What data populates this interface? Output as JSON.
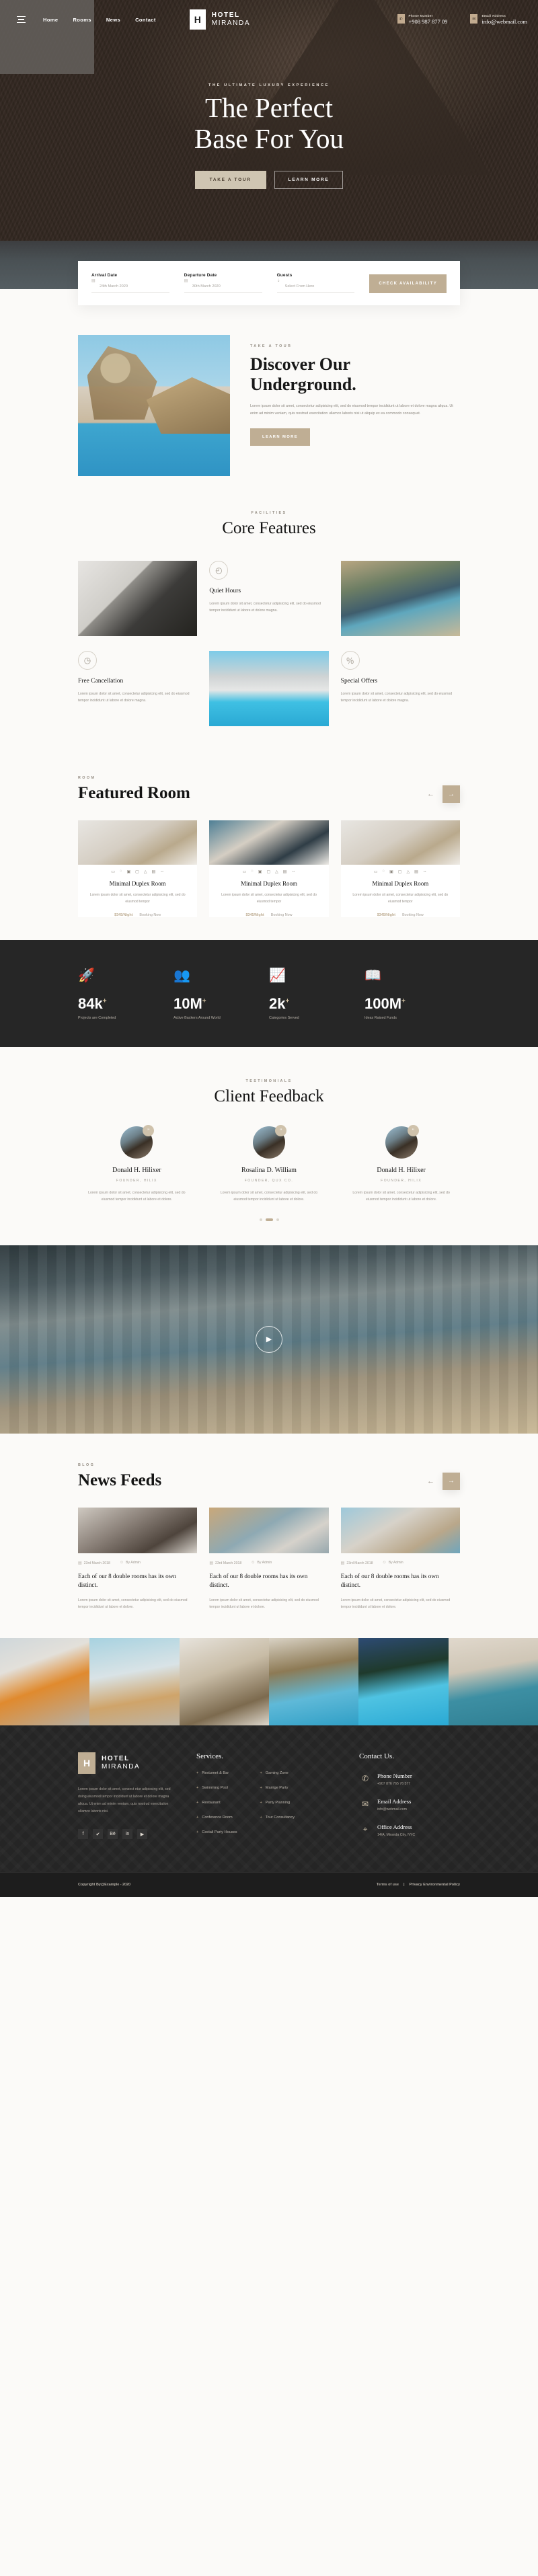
{
  "header": {
    "menu_icon": "hamburger-icon",
    "nav": [
      {
        "label": "Home"
      },
      {
        "label": "Rooms"
      },
      {
        "label": "News"
      },
      {
        "label": "Contact"
      }
    ],
    "logo": {
      "mark": "H",
      "line1": "HOTEL",
      "line2": "MIRANDA"
    },
    "contacts": [
      {
        "icon": "phone-icon",
        "label": "Phone Number",
        "value": "+908 987 877 09"
      },
      {
        "icon": "envelope-icon",
        "label": "Email Address",
        "value": "info@webmail.com"
      }
    ]
  },
  "hero": {
    "kicker": "THE ULTIMATE LUXURY EXPERIENCE",
    "title_line1": "The Perfect",
    "title_line2": "Base For You",
    "primary_button": "TAKE A TOUR",
    "secondary_button": "LEARN MORE"
  },
  "booking": {
    "arrival": {
      "label": "Arrival Date",
      "value": "24th March 2020",
      "icon": "calendar-icon"
    },
    "departure": {
      "label": "Departure Date",
      "value": "30th March 2020",
      "icon": "calendar-icon"
    },
    "guests": {
      "label": "Guests",
      "value": "Select From Here",
      "icon": "user-icon"
    },
    "submit": "CHECK AVAILABILITY"
  },
  "discover": {
    "kicker": "TAKE A TOUR",
    "title_line1": "Discover Our",
    "title_line2": "Underground.",
    "text": "Lorem ipsum dolor sit amet, consectetur adipisicing elit, sed do eiusmod tempor incididunt ut labore et dolore magna aliqua. Ut enim ad minim veniam, quis nostrud exercitation ullamco laboris nisi ut aliquip ex ea commodo consequat.",
    "button": "LEARN MORE"
  },
  "features": {
    "kicker": "FACILITIES",
    "title": "Core Features",
    "items": [
      {
        "icon": "clock-icon",
        "name": "Quiet Hours",
        "desc": "Lorem ipsum dolor sit amet, consectetur adipisicing elit, sed do eiusmod tempor incididunt ut labore et dolore magna."
      },
      {
        "icon": "clock-cancel-icon",
        "name": "Free Cancellation",
        "desc": "Lorem ipsum dolor sit amet, consectetur adipisicing elit, sed do eiusmod tempor incididunt ut labore et dolore magna."
      },
      {
        "icon": "discount-badge-icon",
        "name": "Special Offers",
        "desc": "Lorem ipsum dolor sit amet, consectetur adipisicing elit, sed do eiusmod tempor incididunt ut labore et dolore magna."
      }
    ]
  },
  "rooms": {
    "kicker": "ROOM",
    "title": "Featured Room",
    "prev_icon": "arrow-left-icon",
    "next_icon": "arrow-right-icon",
    "amenity_icons": [
      "bed-icon",
      "wifi-icon",
      "tv-icon",
      "desk-icon",
      "shower-icon",
      "ac-icon",
      "size-icon"
    ],
    "cards": [
      {
        "name": "Minimal Duplex Room",
        "desc": "Lorem ipsum dolor sit amet, consectetur adipisicing elit, sed do eiusmod tempor",
        "price": "$345/Night",
        "action": "Booking Now"
      },
      {
        "name": "Minimal Duplex Room",
        "desc": "Lorem ipsum dolor sit amet, consectetur adipisicing elit, sed do eiusmod tempor",
        "price": "$345/Night",
        "action": "Booking Now"
      },
      {
        "name": "Minimal Duplex Room",
        "desc": "Lorem ipsum dolor sit amet, consectetur adipisicing elit, sed do eiusmod tempor",
        "price": "$345/Night",
        "action": "Booking Now"
      }
    ]
  },
  "stats": [
    {
      "icon": "rocket-icon",
      "number": "84k",
      "suffix": "+",
      "label": "Projects are Completed"
    },
    {
      "icon": "team-icon",
      "number": "10M",
      "suffix": "+",
      "label": "Active Backers Around World"
    },
    {
      "icon": "growth-icon",
      "number": "2k",
      "suffix": "+",
      "label": "Categories Served"
    },
    {
      "icon": "book-icon",
      "number": "100M",
      "suffix": "+",
      "label": "Ideas Raised Funds"
    }
  ],
  "testimonials": {
    "kicker": "TESTIMONIALS",
    "title": "Client Feedback",
    "items": [
      {
        "name": "Donald H. Hilixer",
        "role": "FOUNDER, HILIX",
        "text": "Lorem ipsum dolor sit amet, consectetur adipisicing elit, sed do eiusmod tempor incididunt ut labore et dolore."
      },
      {
        "name": "Rosalina D. William",
        "role": "FOUNDER, QUX CO.",
        "text": "Lorem ipsum dolor sit amet, consectetur adipisicing elit, sed do eiusmod tempor incididunt ut labore et dolore."
      },
      {
        "name": "Donald H. Hilixer",
        "role": "FOUNDER, HILIX",
        "text": "Lorem ipsum dolor sit amet, consectetur adipisicing elit, sed do eiusmod tempor incididunt ut labore et dolore."
      }
    ]
  },
  "video": {
    "play_icon": "play-icon"
  },
  "news": {
    "kicker": "BLOG",
    "title": "News Feeds",
    "prev_icon": "arrow-left-icon",
    "next_icon": "arrow-right-icon",
    "posts": [
      {
        "date": "23rd March 2018",
        "author": "By Admin",
        "title": "Each of our 8 double rooms has its own distinct.",
        "text": "Lorem ipsum dolor sit amet, consectetur adipisicing elit, sed do eiusmod tempor incididunt ut labore et dolore."
      },
      {
        "date": "23rd March 2018",
        "author": "By Admin",
        "title": "Each of our 8 double rooms has its own distinct.",
        "text": "Lorem ipsum dolor sit amet, consectetur adipisicing elit, sed do eiusmod tempor incididunt ut labore et dolore."
      },
      {
        "date": "23rd March 2018",
        "author": "By Admin",
        "title": "Each of our 8 double rooms has its own distinct.",
        "text": "Lorem ipsum dolor sit amet, consectetur adipisicing elit, sed do eiusmod tempor incididunt ut labore et dolore."
      }
    ]
  },
  "footer": {
    "logo": {
      "mark": "H",
      "line1": "HOTEL",
      "line2": "MIRANDA"
    },
    "about": "Lorem ipsum dolor sit amet, consect etur adipiscing elit, sed doing eiusmod tempor incididunt ut labore et dolore magna aliqua. Ut enim ad minim veniam, quis nostrud exercitation ullamco laboris nisi.",
    "socials": [
      "facebook-icon",
      "twitter-icon",
      "behance-icon",
      "linkedin-icon",
      "youtube-icon"
    ],
    "services_head": "Services.",
    "services_col1": [
      "Resturent & Bar",
      "Swimming Pool",
      "Restaurant",
      "Conference Room",
      "Coctail Party Houses"
    ],
    "services_col2": [
      "Gaming Zone",
      "Marrige Party",
      "Party Planning",
      "Tour Consultancy"
    ],
    "contact_head": "Contact Us.",
    "contacts": [
      {
        "icon": "phone-icon",
        "label": "Phone Number",
        "value": "+907 876 765 76 577"
      },
      {
        "icon": "envelope-icon",
        "label": "Email Address",
        "value": "info@webmail.com"
      },
      {
        "icon": "map-pin-icon",
        "label": "Office Address",
        "value": "14/A, Miranda City, NYC"
      }
    ],
    "copyright": "Copyright By@Example - 2020",
    "terms": "Terms of use",
    "separator": "|",
    "privacy": "Privacy Environmental Policy"
  },
  "colors": {
    "accent": "#bfae94",
    "dark": "#252525",
    "page_bg": "#fbfaf8"
  }
}
